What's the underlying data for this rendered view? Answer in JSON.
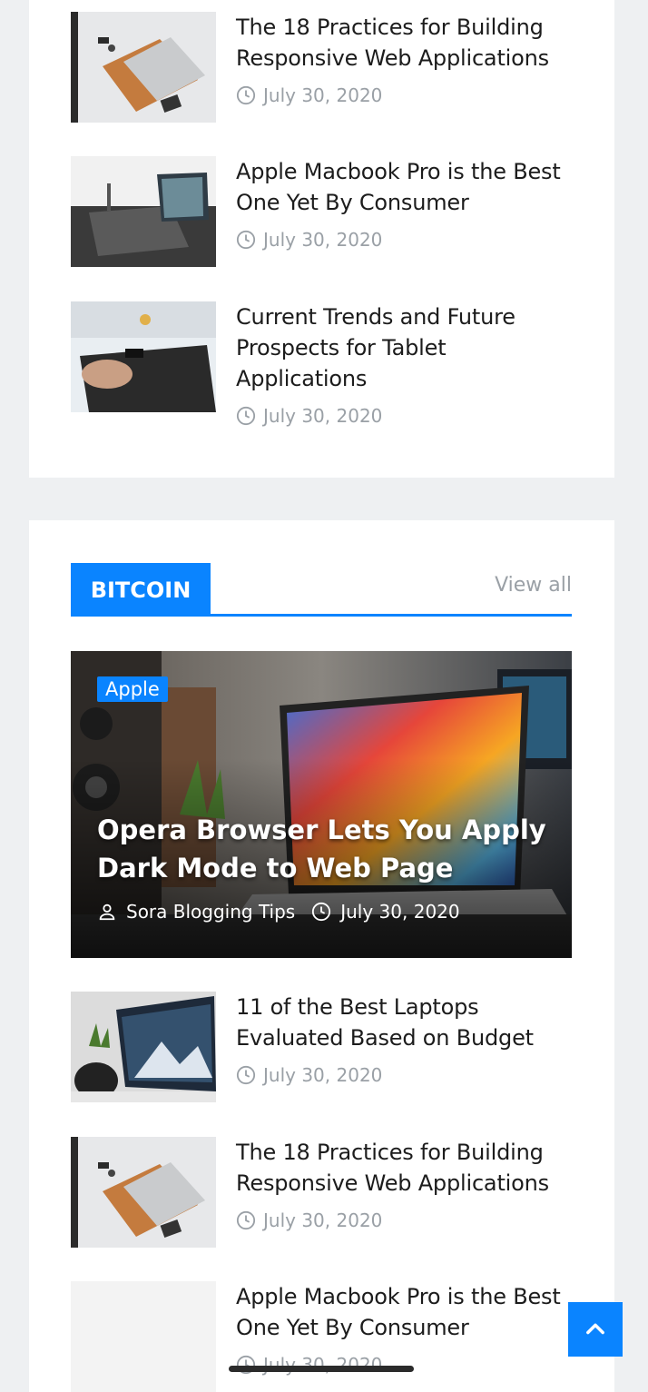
{
  "top_posts": [
    {
      "title": "The 18 Practices for Building Responsive Web Applications",
      "date": "July 30, 2020"
    },
    {
      "title": "Apple Macbook Pro is the Best One Yet By Consumer",
      "date": "July 30, 2020"
    },
    {
      "title": "Current Trends and Future Prospects for Tablet Applications",
      "date": "July 30, 2020"
    }
  ],
  "section": {
    "title": "BITCOIN",
    "view_all": "View all"
  },
  "hero": {
    "badge": "Apple",
    "title": "Opera Browser Lets You Apply Dark Mode to Web Page",
    "author": "Sora Blogging Tips",
    "date": "July 30, 2020"
  },
  "bottom_posts": [
    {
      "title": "11 of the Best Laptops Evaluated Based on Budget",
      "date": "July 30, 2020"
    },
    {
      "title": "The 18 Practices for Building Responsive Web Applications",
      "date": "July 30, 2020"
    },
    {
      "title": "Apple Macbook Pro is the Best One Yet By Consumer",
      "date": "July 30, 2020"
    }
  ],
  "colors": {
    "accent": "#0a84ff",
    "muted": "#9aa0a6"
  }
}
